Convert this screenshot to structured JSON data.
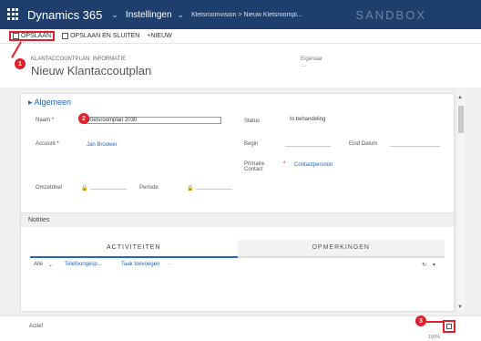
{
  "nav": {
    "brand": "Dynamics 365",
    "area": "Instellingen",
    "breadcrumb": "Kletsroomvision  >  Nieuw Kletsroompl...",
    "environment": "SANDBOX"
  },
  "toolbar": {
    "save_label": "OPSLAAN",
    "save_close_label": "OPSLAAN EN SLUITEN",
    "new_label": "NIEUW"
  },
  "header": {
    "entity": "KLANTACCOUNTPLAN: INFORMATIE",
    "title": "Nieuw Klantaccoutplan",
    "owner_label": "Eigenaar",
    "owner_value": "---"
  },
  "form": {
    "section_title": "Algemeen",
    "name_label": "Naam",
    "name_value": "Kletsroomplan 2030",
    "status_label": "Status",
    "status_value": "In behandeling",
    "account_label": "Account",
    "account_value": "Jan Brouwer",
    "start_label": "Begin",
    "end_label": "Eind Datum",
    "contact_label": "Primaire Contact",
    "contact_value": "Contactpersoon",
    "rev_label": "Omzetdoel",
    "period_label": "Periode",
    "notes_label": "Notities",
    "tab_activities": "ACTIVITEITEN",
    "tab_notes": "OPMERKINGEN",
    "activity_filter": "Alle",
    "activity_link1": "Telefoongesp...",
    "activity_link2": "Taak toevoegen"
  },
  "footer": {
    "status": "Actief",
    "zoom": "100%"
  },
  "steps": {
    "one": "1",
    "two": "2",
    "three": "3"
  },
  "colors": {
    "nav": "#1e3e6e",
    "accent": "#2266c0",
    "highlight": "#e0202a"
  }
}
